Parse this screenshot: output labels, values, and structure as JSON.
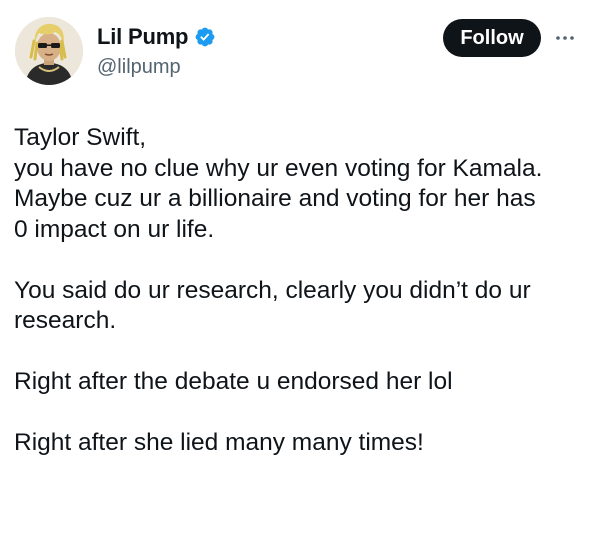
{
  "author": {
    "display_name": "Lil Pump",
    "handle": "@lilpump",
    "verified": true,
    "avatar_icon": "cartoon-portrait-avatar"
  },
  "actions": {
    "follow_label": "Follow",
    "more_icon": "more-dots-icon"
  },
  "tweet": {
    "paragraphs": [
      [
        "Taylor Swift,",
        "you have no clue why ur even voting for Kamala.",
        "Maybe cuz ur a billionaire and voting for her has",
        "0 impact on ur life."
      ],
      [
        "You said do ur research, clearly you didn’t do ur",
        "research."
      ],
      [
        "Right after the debate u endorsed her lol"
      ],
      [
        "Right after she lied many many times!"
      ]
    ]
  },
  "colors": {
    "text": "#0f1419",
    "secondary": "#536471",
    "verified_blue": "#1d9bf0",
    "button_bg": "#0f1419"
  }
}
